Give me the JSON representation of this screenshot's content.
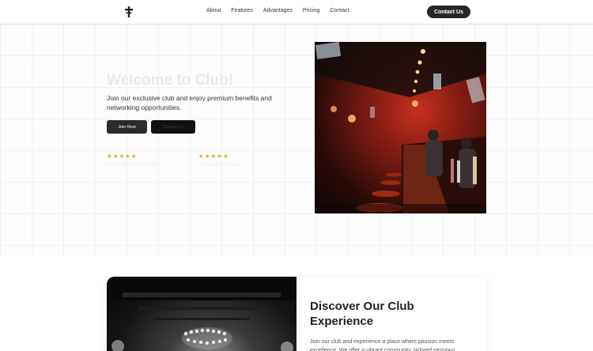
{
  "nav": {
    "logo_icon": "cross-icon",
    "links": [
      "About",
      "Features",
      "Advantages",
      "Pricing",
      "Contact"
    ],
    "cta_label": "Contact Us"
  },
  "hero": {
    "title": "Welcome to Club!",
    "description": "Join our exclusive club and enjoy premium benefits and networking opportunities.",
    "primary_button": "Join Now",
    "secondary_button": "Contact Us",
    "ratings": [
      {
        "stars": "★★★★★",
        "label": "5.0 rating from members",
        "value": 5
      },
      {
        "stars": "★★★★★",
        "label": "4.9 rating on reviews",
        "value": 5
      }
    ],
    "image": "club-bar-photo"
  },
  "feature": {
    "image": "chandelier-photo",
    "title": "Discover Our Club Experience",
    "text": "Join our club and experience a place where passion meets excellence. We offer a vibrant community, tailored sessions"
  },
  "colors": {
    "brand_dark": "#2b2626",
    "star": "#e2ac18",
    "accent_red": "#c8301e"
  }
}
